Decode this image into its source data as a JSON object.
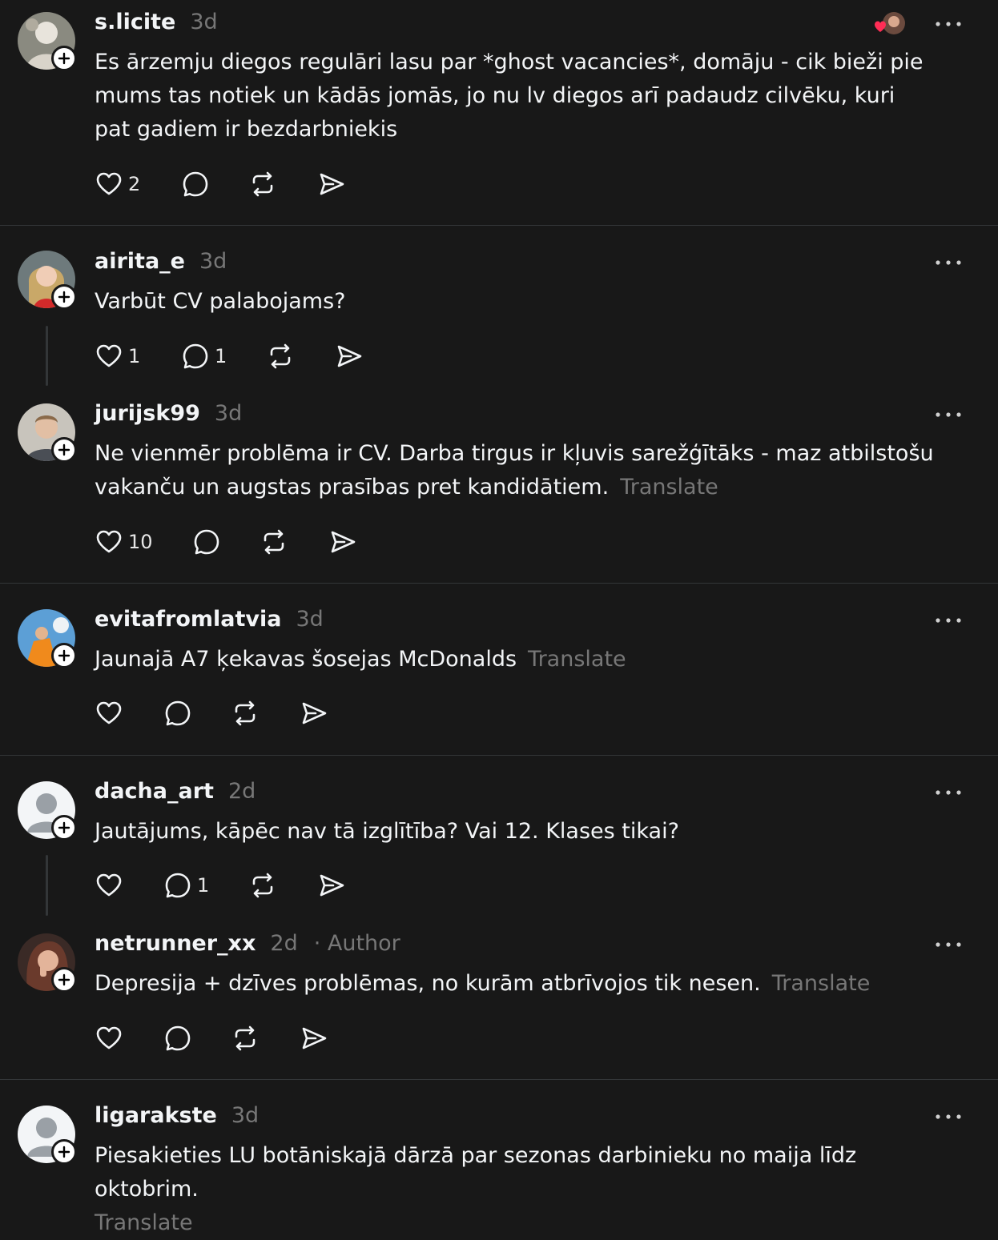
{
  "posts": [
    {
      "username": "s.licite",
      "time": "3d",
      "text": "Es ārzemju diegos regulāri lasu par *ghost vacancies*, domāju - cik bieži pie mums tas notiek un kādās jomās, jo nu lv diegos arī padaudz cilvēku, kuri pat gadiem ir bezdarbniekis",
      "likes": "2",
      "replies": "",
      "avatar": "photo-avatar"
    },
    {
      "username": "airita_e",
      "time": "3d",
      "text": "Varbūt CV palabojams?",
      "likes": "1",
      "replies": "1",
      "avatar": "photo-avatar"
    },
    {
      "username": "jurijsk99",
      "time": "3d",
      "text": "Ne vienmēr problēma ir CV. Darba tirgus ir kļuvis sarežģītāks - maz atbilstošu vakanču un augstas prasības pret kandidātiem.",
      "translate": "Translate",
      "likes": "10",
      "replies": "",
      "avatar": "photo-avatar"
    },
    {
      "username": "evitafromlatvia",
      "time": "3d",
      "text": "Jaunajā A7 ķekavas šosejas McDonalds",
      "translate": "Translate",
      "likes": "",
      "replies": "",
      "avatar": "photo-avatar"
    },
    {
      "username": "dacha_art",
      "time": "2d",
      "text": "Jautājums, kāpēc nav tā izglītība? Vai 12. Klases tikai?",
      "likes": "",
      "replies": "1",
      "avatar": "default-avatar"
    },
    {
      "username": "netrunner_xx",
      "time": "2d",
      "author_tag": "· Author",
      "text": "Depresija + dzīves problēmas, no kurām atbrīvojos tik nesen.",
      "translate": "Translate",
      "likes": "",
      "replies": "",
      "avatar": "photo-avatar"
    },
    {
      "username": "ligarakste",
      "time": "3d",
      "text": "Piesakieties LU botāniskajā dārzā par sezonas darbinieku no maija līdz oktobrim.",
      "translate": "Translate",
      "likes": "",
      "replies": "",
      "avatar": "default-avatar"
    }
  ],
  "colors": {
    "background": "#181818",
    "text": "#f3f5f7",
    "muted": "#777777",
    "divider": "#333638",
    "like_heart": "#ff2d55"
  },
  "icons": [
    "heart-icon",
    "comment-icon",
    "repost-icon",
    "share-icon",
    "more-icon",
    "follow-plus-icon"
  ]
}
